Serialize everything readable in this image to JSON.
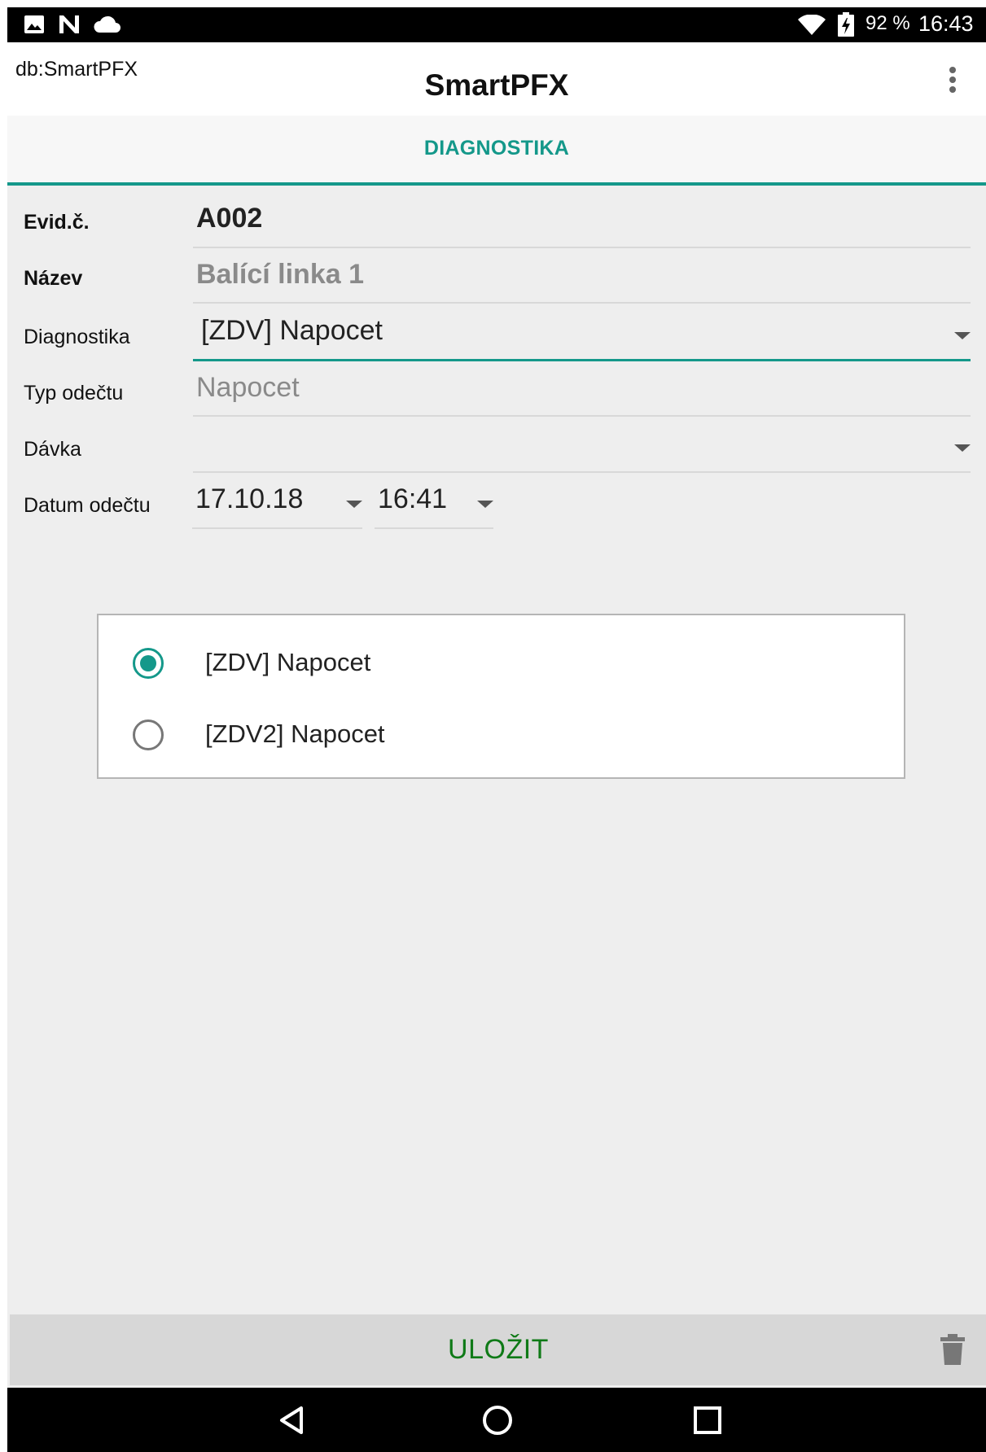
{
  "status_bar": {
    "battery": "92 %",
    "time": "16:43",
    "left_icons": [
      "image-icon",
      "n-icon",
      "cloud-icon"
    ],
    "right_icons": [
      "wifi-icon",
      "battery-charging-icon"
    ]
  },
  "app_bar": {
    "db_label": "db:SmartPFX",
    "title": "SmartPFX",
    "menu_icon": "more-vert-icon"
  },
  "tab": {
    "label": "DIAGNOSTIKA"
  },
  "form": {
    "evid": {
      "label": "Evid.č.",
      "value": "A002"
    },
    "nazev": {
      "label": "Název",
      "value": "Balící linka 1"
    },
    "diagnostika": {
      "label": "Diagnostika",
      "value": "[ZDV] Napocet"
    },
    "typ": {
      "label": "Typ odečtu",
      "value": "Napocet"
    },
    "davka": {
      "label": "Dávka",
      "value": ""
    },
    "datum": {
      "label": "Datum odečtu",
      "date": "17.10.18",
      "time": "16:41"
    }
  },
  "dialog": {
    "options": [
      {
        "label": "[ZDV] Napocet",
        "checked": true
      },
      {
        "label": "[ZDV2] Napocet",
        "checked": false
      }
    ]
  },
  "action_bar": {
    "save_label": "ULOŽIT",
    "delete_icon": "trash-icon"
  },
  "nav_bar": {
    "icons": [
      "back-icon",
      "home-icon",
      "recents-icon"
    ]
  },
  "colors": {
    "accent": "#14988a",
    "save": "#0f7a17",
    "background": "#eeeeee"
  }
}
